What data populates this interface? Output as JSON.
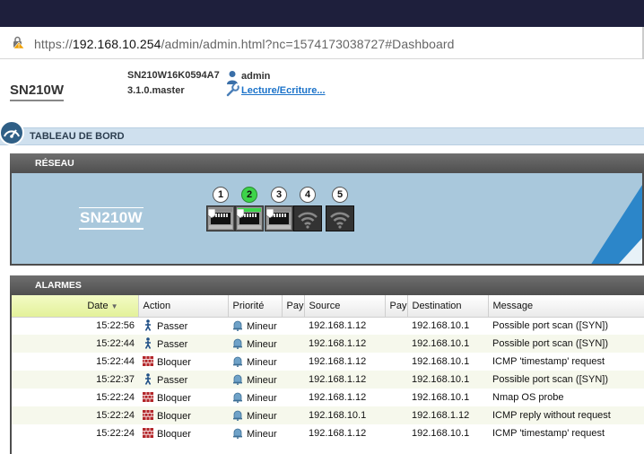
{
  "browser": {
    "url_scheme": "https://",
    "url_host": "192.168.10.254",
    "url_rest": "/admin/admin.html?nc=1574173038727#Dashboard"
  },
  "header": {
    "model": "SN210W",
    "serial": "SN210W16K0594A7",
    "version": "3.1.0.master",
    "user": "admin",
    "access_link": "Lecture/Ecriture..."
  },
  "dashboard": {
    "title": "TABLEAU DE BORD"
  },
  "network": {
    "title": "RÉSEAU",
    "device_label": "SN210W",
    "ports": [
      {
        "number": "1",
        "type": "ethernet",
        "active": false
      },
      {
        "number": "2",
        "type": "ethernet",
        "active": true
      },
      {
        "number": "3",
        "type": "ethernet",
        "active": false
      },
      {
        "number": "4",
        "type": "wifi",
        "active": false
      },
      {
        "number": "5",
        "type": "wifi",
        "active": false
      }
    ]
  },
  "alarms": {
    "title": "ALARMES",
    "columns": [
      "Date",
      "Action",
      "Priorité",
      "Pay",
      "Source",
      "Pay",
      "Destination",
      "Message"
    ],
    "sorted_column": "Date",
    "rows": [
      {
        "date": "15:22:56",
        "action": "Passer",
        "priority": "Mineur",
        "source": "192.168.1.12",
        "destination": "192.168.10.1",
        "message": "Possible port scan ([SYN])"
      },
      {
        "date": "15:22:44",
        "action": "Passer",
        "priority": "Mineur",
        "source": "192.168.1.12",
        "destination": "192.168.10.1",
        "message": "Possible port scan ([SYN])"
      },
      {
        "date": "15:22:44",
        "action": "Bloquer",
        "priority": "Mineur",
        "source": "192.168.1.12",
        "destination": "192.168.10.1",
        "message": "ICMP 'timestamp' request"
      },
      {
        "date": "15:22:37",
        "action": "Passer",
        "priority": "Mineur",
        "source": "192.168.1.12",
        "destination": "192.168.10.1",
        "message": "Possible port scan ([SYN])"
      },
      {
        "date": "15:22:24",
        "action": "Bloquer",
        "priority": "Mineur",
        "source": "192.168.1.12",
        "destination": "192.168.10.1",
        "message": "Nmap OS probe"
      },
      {
        "date": "15:22:24",
        "action": "Bloquer",
        "priority": "Mineur",
        "source": "192.168.10.1",
        "destination": "192.168.1.12",
        "message": "ICMP reply without request"
      },
      {
        "date": "15:22:24",
        "action": "Bloquer",
        "priority": "Mineur",
        "source": "192.168.1.12",
        "destination": "192.168.10.1",
        "message": "ICMP 'timestamp' request"
      }
    ]
  },
  "colors": {
    "topbar": "#1e1f3c",
    "link": "#1a72c9",
    "active_port": "#3dd44a",
    "network_bg": "#a9c8dc",
    "sorted_header": "#e3f19a"
  }
}
